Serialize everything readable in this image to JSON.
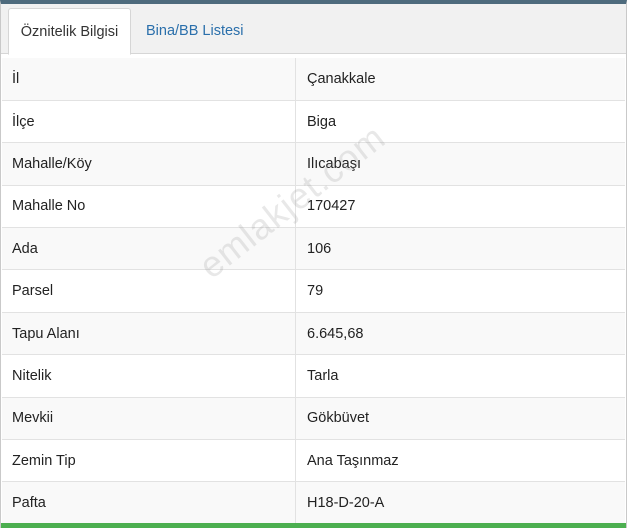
{
  "tabs": [
    {
      "label": "Öznitelik Bilgisi",
      "active": true
    },
    {
      "label": "Bina/BB Listesi",
      "active": false
    }
  ],
  "rows": [
    {
      "key": "İl",
      "value": "Çanakkale"
    },
    {
      "key": "İlçe",
      "value": "Biga"
    },
    {
      "key": "Mahalle/Köy",
      "value": "Ilıcabaşı"
    },
    {
      "key": "Mahalle No",
      "value": "170427"
    },
    {
      "key": "Ada",
      "value": "106"
    },
    {
      "key": "Parsel",
      "value": "79"
    },
    {
      "key": "Tapu Alanı",
      "value": "6.645,68"
    },
    {
      "key": "Nitelik",
      "value": "Tarla"
    },
    {
      "key": "Mevkii",
      "value": "Gökbüvet"
    },
    {
      "key": "Zemin Tip",
      "value": "Ana Taşınmaz"
    },
    {
      "key": "Pafta",
      "value": "H18-D-20-A"
    }
  ],
  "watermark": "emlakjet.com",
  "colors": {
    "accent_top": "#4e6b7d",
    "tab_link": "#2a6fab",
    "bottom_bar": "#4caf50"
  }
}
